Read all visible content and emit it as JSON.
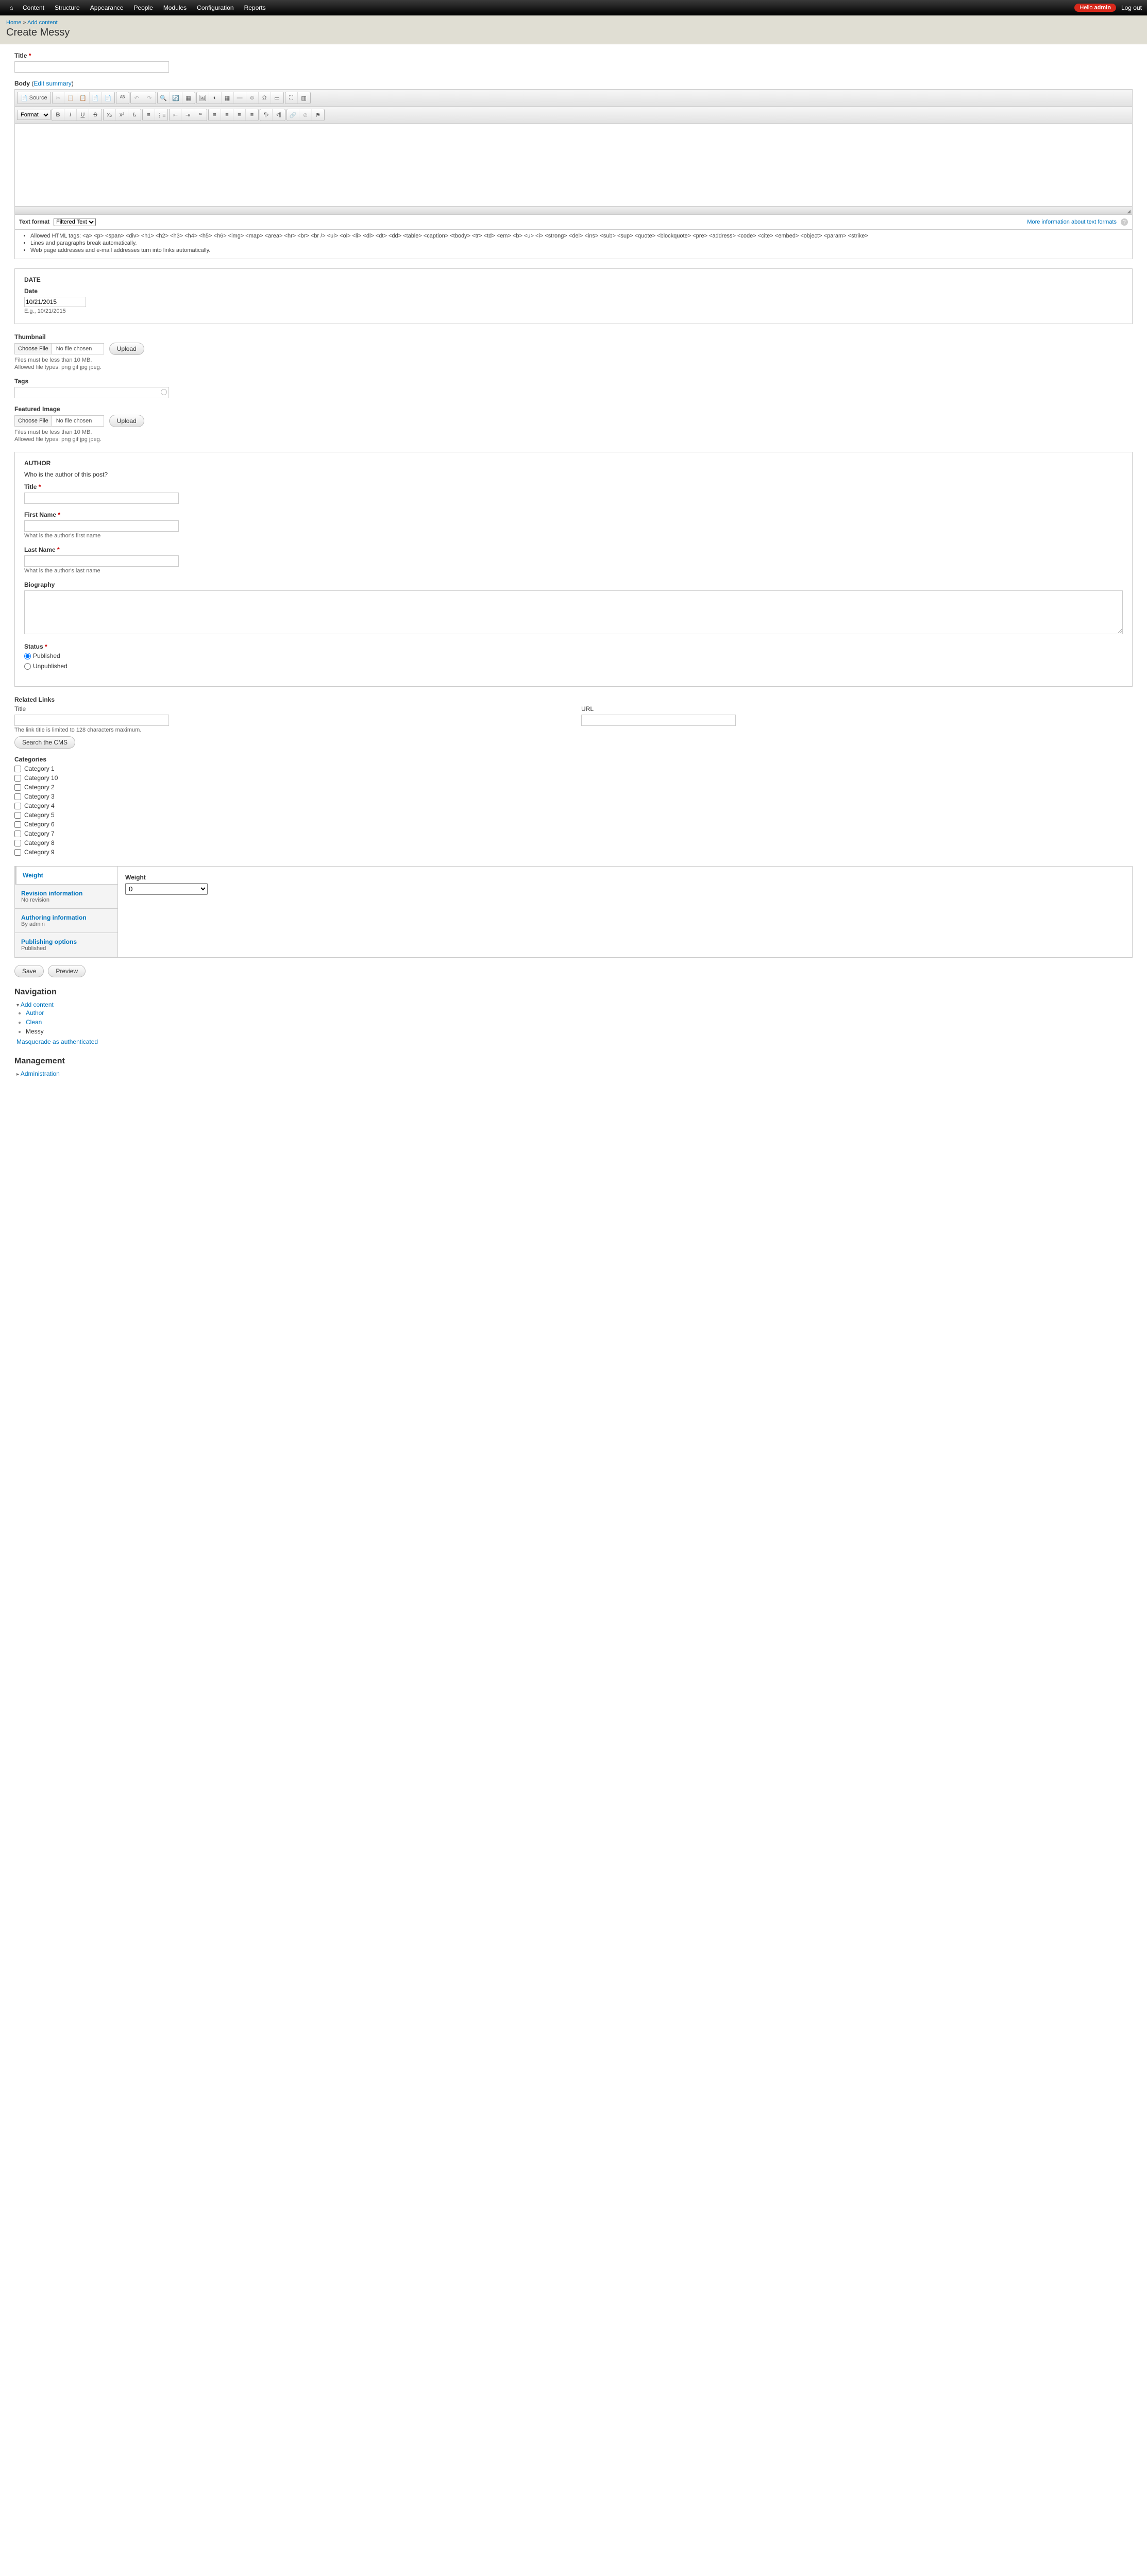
{
  "topbar": {
    "menu": [
      "Content",
      "Structure",
      "Appearance",
      "People",
      "Modules",
      "Configuration",
      "Reports"
    ],
    "hello_prefix": "Hello ",
    "hello_user": "admin",
    "logout": "Log out"
  },
  "breadcrumb": {
    "home": "Home",
    "sep": " » ",
    "add": "Add content"
  },
  "page_title": "Create Messy",
  "title_field": {
    "label": "Title "
  },
  "body_field": {
    "label": "Body ",
    "edit_summary": "Edit summary",
    "source_label": "Source",
    "format_placeholder": "Format"
  },
  "text_format": {
    "label": "Text format",
    "options": [
      "Filtered Text"
    ],
    "more_link": "More information about text formats",
    "bullets": [
      "Allowed HTML tags: <a> <p> <span> <div> <h1> <h2> <h3> <h4> <h5> <h6> <img> <map> <area> <hr> <br> <br /> <ul> <ol> <li> <dl> <dt> <dd> <table> <caption> <tbody> <tr> <td> <em> <b> <u> <i> <strong> <del> <ins> <sub> <sup> <quote> <blockquote> <pre> <address> <code> <cite> <embed> <object> <param> <strike>",
      "Lines and paragraphs break automatically.",
      "Web page addresses and e-mail addresses turn into links automatically."
    ]
  },
  "date_group": {
    "legend": "DATE",
    "label": "Date",
    "value": "10/21/2015",
    "example": "E.g., 10/21/2015"
  },
  "thumbnail": {
    "label": "Thumbnail",
    "choose": "Choose File",
    "no_file": "No file chosen",
    "upload": "Upload",
    "desc1": "Files must be less than 10 MB.",
    "desc2": "Allowed file types: png gif jpg jpeg."
  },
  "tags": {
    "label": "Tags"
  },
  "featured": {
    "label": "Featured Image",
    "choose": "Choose File",
    "no_file": "No file chosen",
    "upload": "Upload",
    "desc1": "Files must be less than 10 MB.",
    "desc2": "Allowed file types: png gif jpg jpeg."
  },
  "author_group": {
    "legend": "AUTHOR",
    "who": "Who is the author of this post?",
    "title_label": "Title ",
    "first_label": "First Name ",
    "first_desc": "What is the author's first name",
    "last_label": "Last Name ",
    "last_desc": "What is the author's last name",
    "bio_label": "Biography",
    "status_label": "Status ",
    "published": "Published",
    "unpublished": "Unpublished"
  },
  "related": {
    "heading": "Related Links",
    "title_label": "Title",
    "title_desc": "The link title is limited to 128 characters maximum.",
    "url_label": "URL",
    "search_btn": "Search the CMS"
  },
  "categories": {
    "heading": "Categories",
    "items": [
      "Category 1",
      "Category 10",
      "Category 2",
      "Category 3",
      "Category 4",
      "Category 5",
      "Category 6",
      "Category 7",
      "Category 8",
      "Category 9"
    ]
  },
  "vtabs": {
    "weight_title": "Weight",
    "revision_title": "Revision information",
    "revision_sub": "No revision",
    "authoring_title": "Authoring information",
    "authoring_sub": "By admin",
    "publishing_title": "Publishing options",
    "publishing_sub": "Published",
    "body_label": "Weight",
    "body_value": "0"
  },
  "actions": {
    "save": "Save",
    "preview": "Preview"
  },
  "navigation": {
    "heading": "Navigation",
    "add_content": "Add content",
    "items": [
      "Author",
      "Clean",
      "Messy"
    ],
    "masquerade": "Masquerade as authenticated"
  },
  "management": {
    "heading": "Management",
    "admin": "Administration"
  }
}
